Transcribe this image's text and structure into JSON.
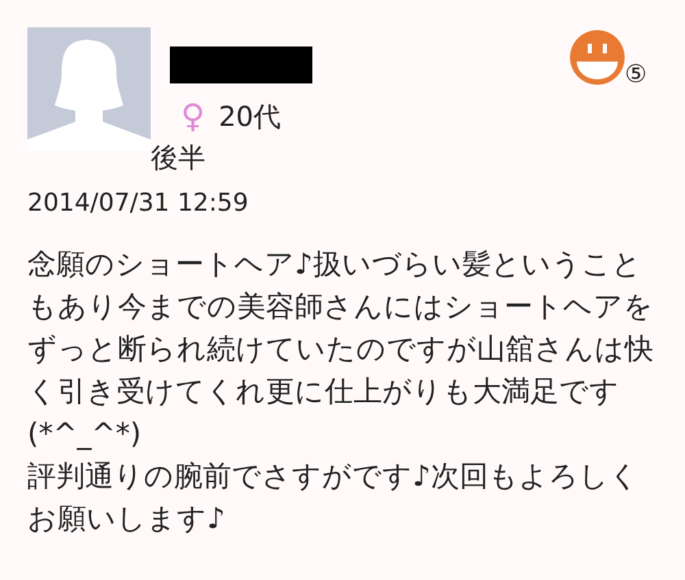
{
  "reviewer": {
    "gender_symbol": "♀",
    "age_lines": [
      "20代",
      "後半"
    ]
  },
  "rating": {
    "kind": "smile",
    "badge": "⑤"
  },
  "date": "2014/07/31 12:59",
  "review": [
    "念願のショートヘア♪扱いづらい髪ということもあり今までの美容師さんにはショートヘアをずっと断られ続けていたのですが山舘さんは快く引き受けてくれ更に仕上がりも大満足です(*^_^*)",
    "評判通りの腕前でさすがです♪次回もよろしくお願いします♪"
  ]
}
